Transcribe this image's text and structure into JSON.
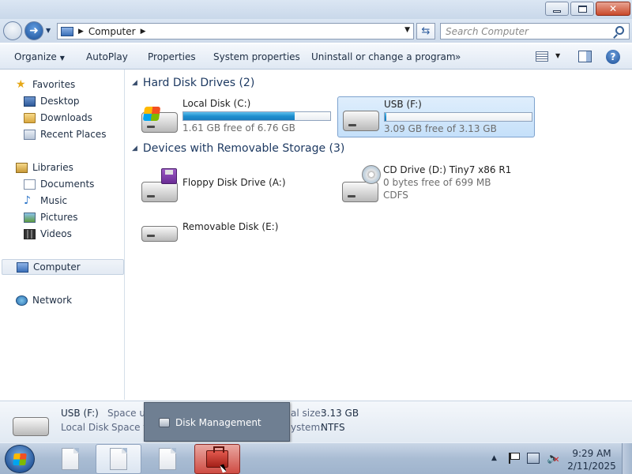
{
  "window": {
    "buttons": {
      "minimize": "minimize",
      "maximize": "maximize",
      "close": "✕"
    }
  },
  "address": {
    "breadcrumb": "Computer",
    "search_placeholder": "Search Computer"
  },
  "toolbar": {
    "organize": "Organize",
    "autoplay": "AutoPlay",
    "properties": "Properties",
    "system_properties": "System properties",
    "uninstall": "Uninstall or change a program",
    "more": "»",
    "help": "?"
  },
  "sidebar": {
    "favorites": "Favorites",
    "desktop": "Desktop",
    "downloads": "Downloads",
    "recent_places": "Recent Places",
    "libraries": "Libraries",
    "documents": "Documents",
    "music": "Music",
    "pictures": "Pictures",
    "videos": "Videos",
    "computer": "Computer",
    "network": "Network"
  },
  "main": {
    "hdd_group": "Hard Disk Drives (2)",
    "removable_group": "Devices with Removable Storage (3)",
    "drives": [
      {
        "name": "Local Disk (C:)",
        "free_text": "1.61 GB free of 6.76 GB",
        "used_fraction": 0.76,
        "icon": "windows-drive-icon"
      },
      {
        "name": "USB (F:)",
        "free_text": "3.09 GB free of 3.13 GB",
        "used_fraction": 0.01,
        "icon": "hard-drive-icon",
        "selected": true
      }
    ],
    "removable": [
      {
        "name": "Floppy Disk Drive (A:)",
        "icon": "floppy-drive-icon"
      },
      {
        "name": "CD Drive (D:) Tiny7 x86 R1",
        "line2": "0 bytes free of 699 MB",
        "line3": "CDFS",
        "icon": "cd-drive-icon"
      },
      {
        "name": "Removable Disk (E:)",
        "icon": "removable-disk-icon"
      }
    ]
  },
  "details": {
    "name": "USB (F:)",
    "type": "Local Disk",
    "space_used_label": "Space us",
    "space_free_label": "Space fr",
    "total_size_label": "al size:",
    "total_size_value": "3.13 GB",
    "fs_label": "ystem:",
    "fs_value": "NTFS"
  },
  "popup": {
    "item": "Disk Management"
  },
  "taskbar": {
    "time": "9:29 AM",
    "date": "2/11/2025"
  },
  "colors": {
    "accent": "#1f8fcf",
    "selection": "#c5e0fa",
    "close_button": "#c94a2b"
  }
}
